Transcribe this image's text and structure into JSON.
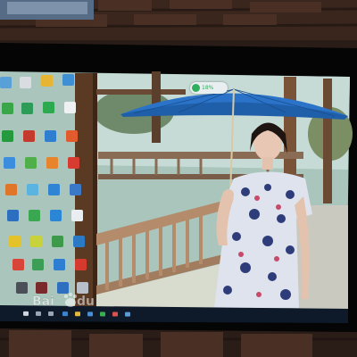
{
  "photo": {
    "subject": "monitor-showing-desktop"
  },
  "desktop": {
    "icon_count": 36,
    "widget": {
      "percent_label": "18%",
      "icon": "speed-ball-icon"
    },
    "taskbar": {
      "icons": [
        "start-icon",
        "search-icon",
        "task-view-icon",
        "edge-icon",
        "folder-icon",
        "store-icon",
        "app-icon",
        "app-icon",
        "app-icon"
      ],
      "clock": ""
    }
  },
  "watermark": {
    "text": "Bai du"
  },
  "colors": {
    "wood": "#3a231a",
    "screen_sky": "#b6d1c7",
    "umbrella": "#2a73c8",
    "dress_floral": "#2e3d7a",
    "taskbar": "#0e1a2a"
  }
}
